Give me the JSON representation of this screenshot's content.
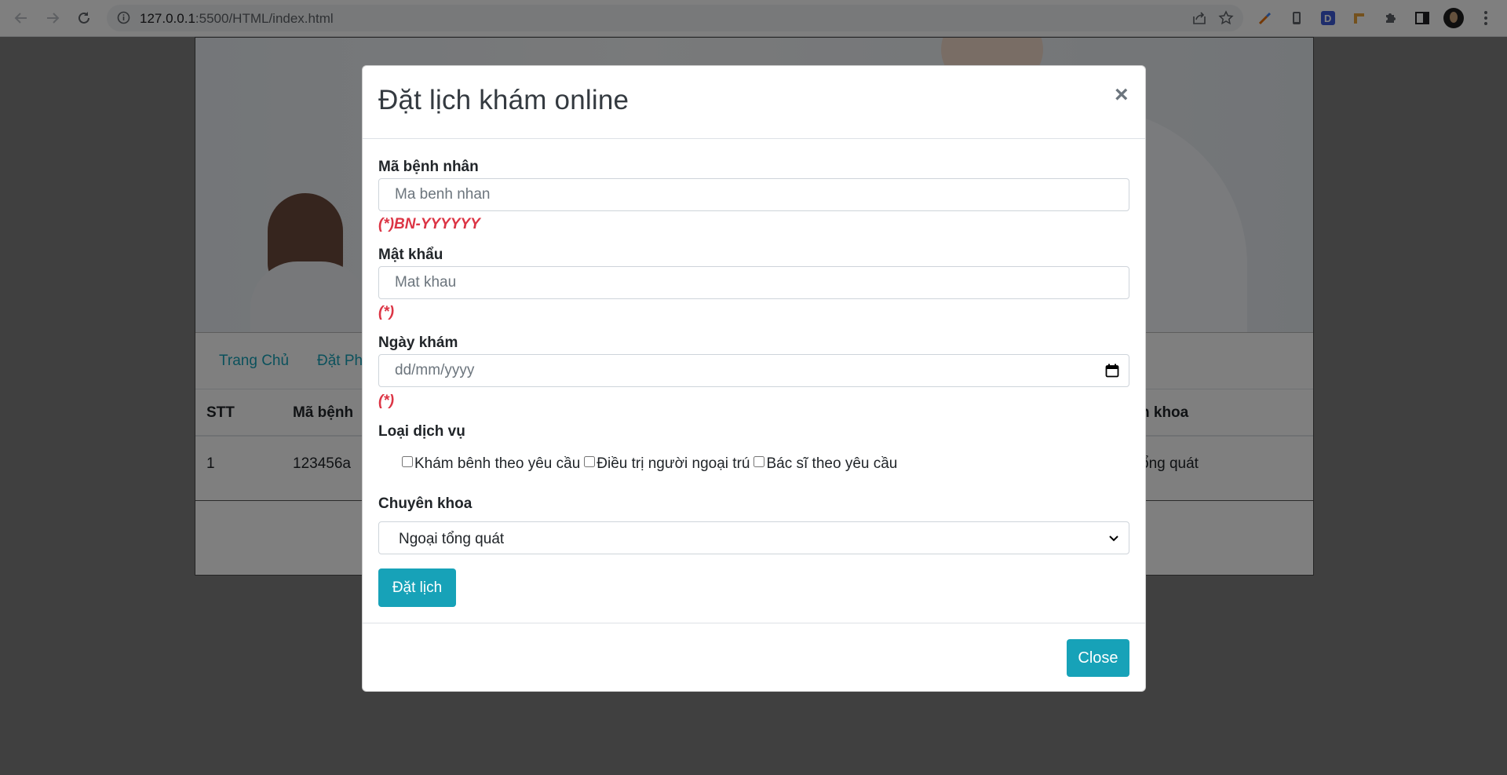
{
  "browser": {
    "url_host": "127.0.0.1",
    "url_path": ":5500/HTML/index.html"
  },
  "page": {
    "nav": [
      "Trang Chủ",
      "Đặt Ph"
    ],
    "table": {
      "headers": [
        "STT",
        "Mã bệnh",
        "n khoa"
      ],
      "row": [
        "1",
        "123456a",
        "ổng quát"
      ]
    }
  },
  "modal": {
    "title": "Đặt lịch khám online",
    "close_x": "×",
    "patient_id": {
      "label": "Mã bệnh nhân",
      "placeholder": "Ma benh nhan",
      "hint": "(*)BN-YYYYYY"
    },
    "password": {
      "label": "Mật khẩu",
      "placeholder": "Mat khau",
      "hint": "(*)"
    },
    "date": {
      "label": "Ngày khám",
      "placeholder": "dd/mm/yyyy",
      "hint": "(*)"
    },
    "services": {
      "label": "Loại dịch vụ",
      "options": [
        "Khám bênh theo yêu cầu",
        "Điều trị người ngoại trú",
        "Bác sĩ theo yêu cầu"
      ]
    },
    "specialty": {
      "label": "Chuyên khoa",
      "selected": "Ngoại tổng quát"
    },
    "submit_label": "Đặt lịch",
    "close_label": "Close"
  },
  "colors": {
    "accent": "#17a2b8",
    "error": "#dc3545",
    "backdrop": "#808080"
  }
}
